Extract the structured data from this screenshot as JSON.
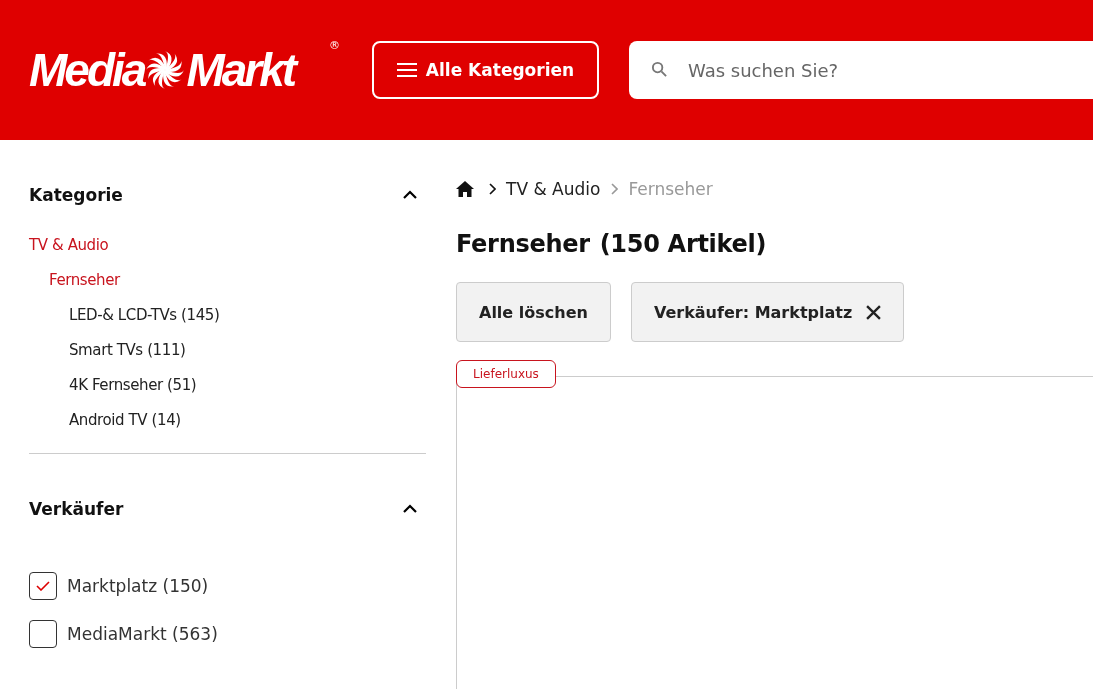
{
  "header": {
    "logo": {
      "left": "Media",
      "right": "Markt",
      "mark": "®"
    },
    "menu_button": "Alle Kategorien",
    "search": {
      "placeholder": "Was suchen Sie?"
    }
  },
  "sidebar": {
    "sections": [
      {
        "kind": "tree",
        "title": "Kategorie",
        "expanded": true,
        "items": [
          {
            "label": "TV & Audio",
            "active": true,
            "children": [
              {
                "label": "Fernseher",
                "active": true,
                "children": [
                  {
                    "label": "LED-& LCD-TVs (145)",
                    "active": false
                  },
                  {
                    "label": "Smart TVs (111)",
                    "active": false
                  },
                  {
                    "label": "4K Fernseher (51)",
                    "active": false
                  },
                  {
                    "label": "Android TV (14)",
                    "active": false
                  }
                ]
              }
            ]
          }
        ]
      },
      {
        "kind": "checklist",
        "title": "Verkäufer",
        "expanded": true,
        "items": [
          {
            "label": "Marktplatz (150)",
            "checked": true
          },
          {
            "label": "MediaMarkt (563)",
            "checked": false
          }
        ]
      }
    ]
  },
  "breadcrumb": [
    {
      "label": "TV & Audio",
      "current": false
    },
    {
      "label": "Fernseher",
      "current": true
    }
  ],
  "heading": {
    "title": "Fernseher",
    "count": "(150 Artikel)"
  },
  "filters": {
    "clear": "Alle löschen",
    "chips": [
      "Verkäufer: Marktplatz"
    ]
  },
  "product_tag": "Lieferluxus"
}
